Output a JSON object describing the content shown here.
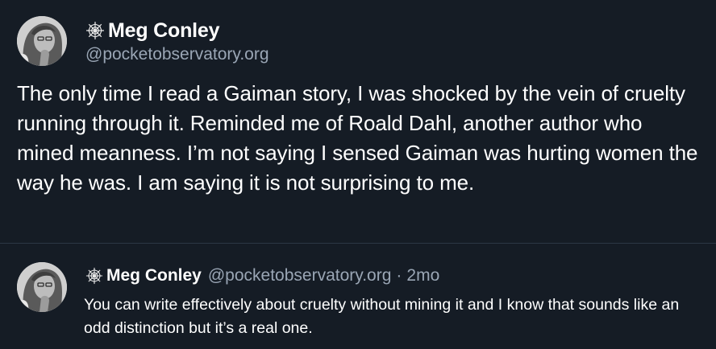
{
  "main_post": {
    "author": {
      "display_name": "Meg Conley",
      "handle": "@pocketobservatory.org",
      "name_icon": "spiderweb-icon",
      "avatar": "avatar-photo"
    },
    "text": "The only time I read a Gaiman story, I was shocked by the vein of cruelty running through it. Reminded me of Roald Dahl, another author who mined meanness. I’m not saying I sensed Gaiman was hurting women the way he was. I am saying it is not surprising to me."
  },
  "reply_post": {
    "author": {
      "display_name": "Meg Conley",
      "handle": "@pocketobservatory.org",
      "name_icon": "spiderweb-icon",
      "avatar": "avatar-photo"
    },
    "separator": "·",
    "timestamp": "2mo",
    "text": "You can write effectively about cruelty without mining it and I know that sounds like an odd distinction but it’s a real one."
  },
  "colors": {
    "background": "#151c25",
    "text_primary": "#ffffff",
    "text_secondary": "#9aa6b5",
    "divider": "#2c3745"
  }
}
